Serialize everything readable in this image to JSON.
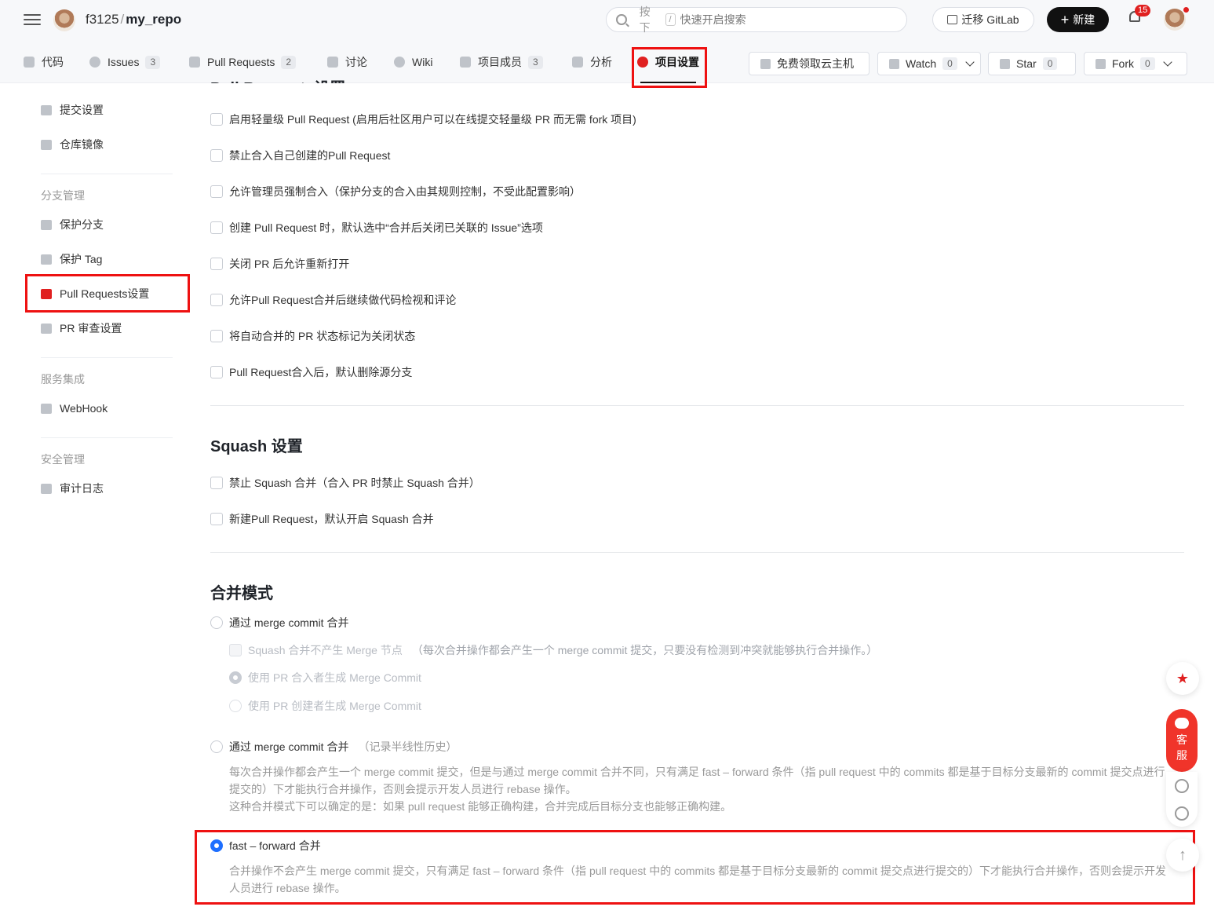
{
  "header": {
    "owner": "f3125",
    "separator": "/",
    "repo": "my_repo",
    "search_key": "按下",
    "search_slash": "/",
    "search_placeholder": "快速开启搜索",
    "migrate_label": "迁移 GitLab",
    "new_label": "新建",
    "new_plus": "+",
    "notification_count": "15"
  },
  "tabs": [
    {
      "label": "代码",
      "icon": "code-icon"
    },
    {
      "label": "Issues",
      "count": "3",
      "icon": "issue-icon"
    },
    {
      "label": "Pull Requests",
      "count": "2",
      "icon": "pull-request-icon"
    },
    {
      "label": "讨论",
      "icon": "discussion-icon"
    },
    {
      "label": "Wiki",
      "icon": "wiki-icon"
    },
    {
      "label": "项目成员",
      "count": "3",
      "icon": "members-icon"
    },
    {
      "label": "分析",
      "icon": "chart-icon"
    },
    {
      "label": "项目设置",
      "icon": "settings-icon",
      "active": true
    }
  ],
  "actions": {
    "cloud_label": "免费领取云主机",
    "watch_label": "Watch",
    "watch_count": "0",
    "star_label": "Star",
    "star_count": "0",
    "fork_label": "Fork",
    "fork_count": "0"
  },
  "sidebar": {
    "items_top": [
      "提交设置",
      "仓库镜像"
    ],
    "group_branch": "分支管理",
    "branch_items": [
      "保护分支",
      "保护 Tag",
      "Pull Requests设置",
      "PR 审查设置"
    ],
    "group_service": "服务集成",
    "service_items": [
      "WebHook"
    ],
    "group_security": "安全管理",
    "security_items": [
      "审计日志"
    ]
  },
  "pr_settings": {
    "title_clipped": "Pull Requests设置",
    "options": [
      "启用轻量级 Pull Request (启用后社区用户可以在线提交轻量级 PR 而无需 fork 项目)",
      "禁止合入自己创建的Pull Request",
      "允许管理员强制合入（保护分支的合入由其规则控制，不受此配置影响）",
      "创建 Pull Request 时，默认选中“合并后关闭已关联的 Issue”选项",
      "关闭 PR 后允许重新打开",
      "允许Pull Request合并后继续做代码检视和评论",
      "将自动合并的 PR 状态标记为关闭状态",
      "Pull Request合入后，默认删除源分支"
    ]
  },
  "squash": {
    "title": "Squash 设置",
    "options": [
      "禁止 Squash 合并（合入 PR 时禁止 Squash 合并）",
      "新建Pull Request，默认开启 Squash 合并"
    ]
  },
  "merge_mode": {
    "title": "合并模式",
    "opt1_label": "通过 merge commit 合并",
    "opt1_sub_cb": "Squash 合并不产生 Merge 节点",
    "opt1_sub_cb_hint": "（每次合并操作都会产生一个 merge commit 提交，只要没有检测到冲突就能够执行合并操作。）",
    "opt1_sub_r1": "使用 PR 合入者生成 Merge Commit",
    "opt1_sub_r2": "使用 PR 创建者生成 Merge Commit",
    "opt2_label": "通过 merge commit 合并",
    "opt2_hint": "（记录半线性历史）",
    "opt2_desc1": "每次合并操作都会产生一个 merge commit 提交，但是与通过 merge commit 合并不同，只有满足 fast – forward 条件（指 pull request 中的 commits 都是基于目标分支最新的 commit 提交点进行提交的）下才能执行合并操作，否则会提示开发人员进行 rebase 操作。",
    "opt2_desc2": "这种合并模式下可以确定的是：如果 pull request 能够正确构建，合并完成后目标分支也能够正确构建。",
    "opt3_label": "fast – forward 合并",
    "opt3_desc": "合并操作不会产生 merge commit 提交，只有满足 fast – forward 条件（指 pull request 中的 commits 都是基于目标分支最新的 commit 提交点进行提交的）下才能执行合并操作，否则会提示开发人员进行 rebase 操作。",
    "selected": "fast-forward"
  },
  "float": {
    "service_label_1": "客",
    "service_label_2": "服"
  },
  "colors": {
    "accent_red": "#e02020",
    "radio_blue": "#1e6fff",
    "highlight_box": "#ee1111"
  }
}
